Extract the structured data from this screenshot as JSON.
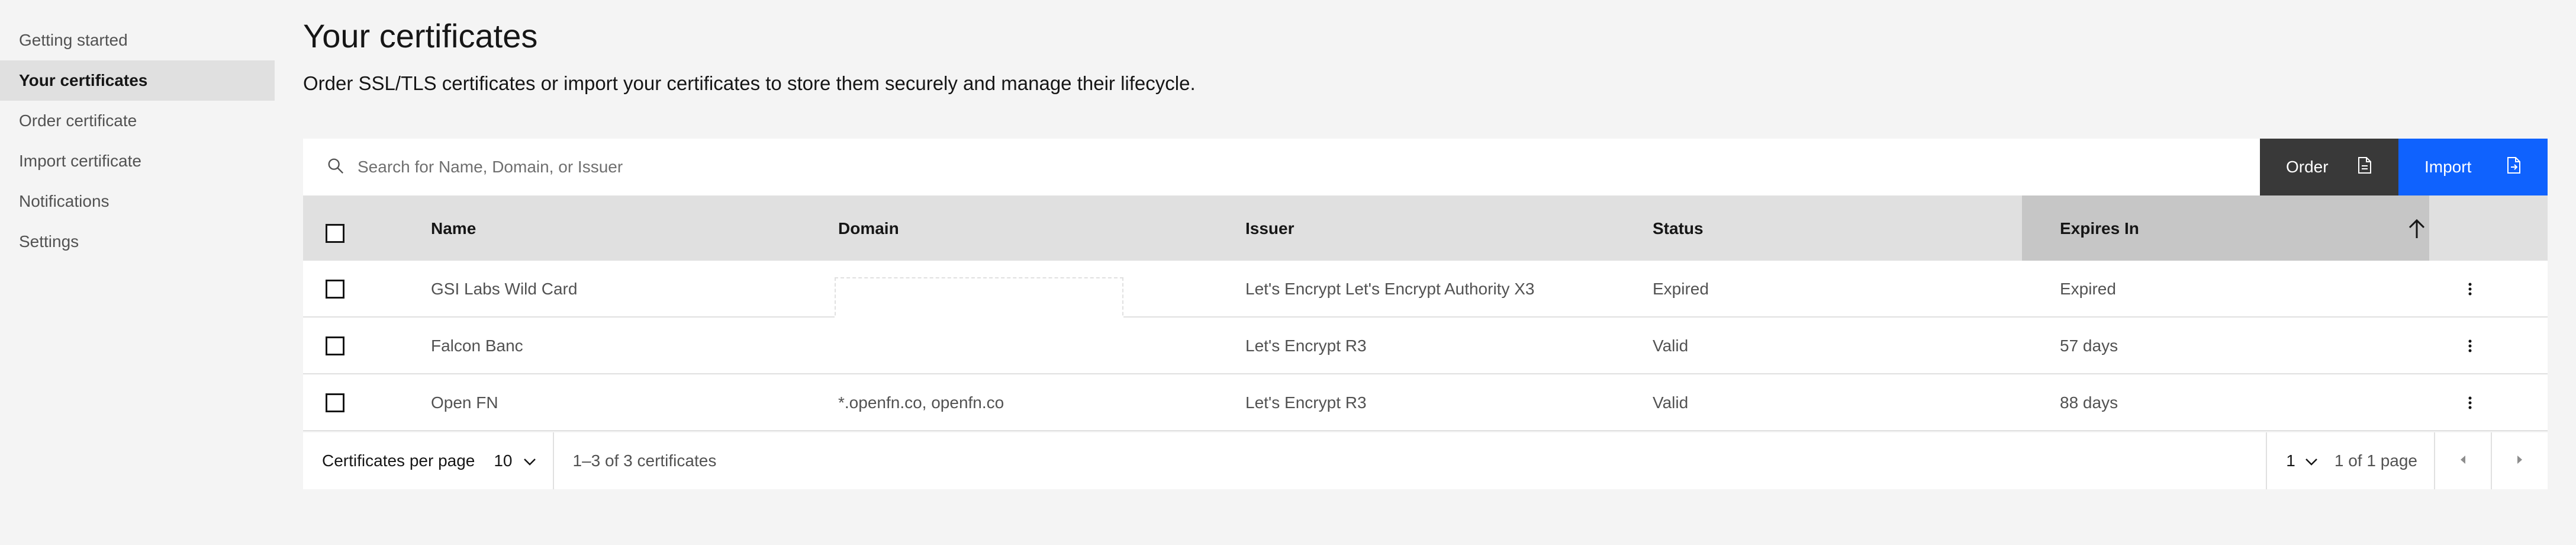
{
  "sidebar": {
    "items": [
      {
        "label": "Getting started"
      },
      {
        "label": "Your certificates",
        "active": true
      },
      {
        "label": "Order certificate"
      },
      {
        "label": "Import certificate"
      },
      {
        "label": "Notifications"
      },
      {
        "label": "Settings"
      }
    ]
  },
  "page": {
    "title": "Your certificates",
    "description": "Order SSL/TLS certificates or import your certificates to store them securely and manage their lifecycle."
  },
  "toolbar": {
    "search_placeholder": "Search for Name, Domain, or Issuer",
    "order_label": "Order",
    "import_label": "Import"
  },
  "table": {
    "headers": {
      "name": "Name",
      "domain": "Domain",
      "issuer": "Issuer",
      "status": "Status",
      "expires": "Expires In"
    },
    "sorted_column": "Expires In",
    "sort_direction": "ascending",
    "rows": [
      {
        "name": "GSI Labs Wild Card",
        "domain": "",
        "issuer": "Let's Encrypt Let's Encrypt Authority X3",
        "status": "Expired",
        "expires": "Expired"
      },
      {
        "name": "Falcon Banc",
        "domain": "",
        "issuer": "Let's Encrypt R3",
        "status": "Valid",
        "expires": "57 days"
      },
      {
        "name": "Open FN",
        "domain": "*.openfn.co, openfn.co",
        "issuer": "Let's Encrypt R3",
        "status": "Valid",
        "expires": "88 days"
      }
    ]
  },
  "pagination": {
    "per_page_label": "Certificates per page",
    "per_page_value": "10",
    "range_text": "1–3 of 3 certificates",
    "page_value": "1",
    "page_of_text": "1 of 1 page"
  },
  "colors": {
    "primary_button": "#0f62fe",
    "secondary_button": "#393939",
    "background": "#f4f4f4",
    "header_row": "#e0e0e0"
  },
  "icons": [
    "search-icon",
    "document-icon",
    "document-import-icon",
    "sort-arrow-up-icon",
    "overflow-menu-icon",
    "chevron-down-icon",
    "caret-left-icon",
    "caret-right-icon"
  ]
}
